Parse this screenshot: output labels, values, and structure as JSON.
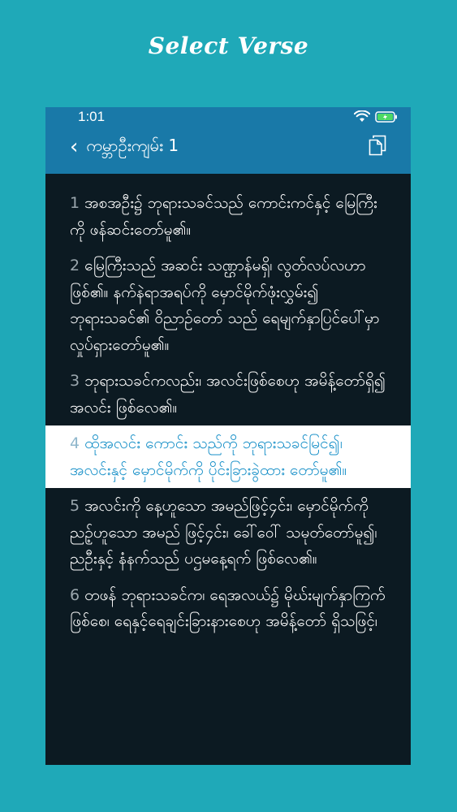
{
  "promo": {
    "title": "Select Verse"
  },
  "status_bar": {
    "time": "1:01"
  },
  "header": {
    "back_icon": "chevron-left-icon",
    "title": "ကမ္ဘာဦးကျမ်း 1",
    "copy_icon": "copy-icon"
  },
  "colors": {
    "background": "#1fa9b8",
    "appbar": "#1979a8",
    "content_bg": "#0c1a22",
    "selected_bg": "#ffffff",
    "selected_text": "#1890c8",
    "battery": "#4cd964"
  },
  "verses": [
    {
      "num": "1",
      "text": "အစအဦး၌ ဘုရားသခင်သည် ကောင်းကင်နှင့် မြေကြီးကို ဖန်ဆင်းတော်မူ၏။",
      "selected": false
    },
    {
      "num": "2",
      "text": "မြေကြီးသည် အဆင်း သဏ္ဌာန်မရှိ၊ လွတ်လပ်လဟာဖြစ်၏။ နက်နဲရာအရပ်ကို မှောင်မိုက်ဖုံးလွှမ်း၍ ဘုရားသခင်၏ ဝိညာဉ်တော် သည် ရေမျက်နှာပြင်ပေါ်မှာ လှုပ်ရှားတော်မူ၏။",
      "selected": false
    },
    {
      "num": "3",
      "text": "ဘုရားသခင်ကလည်း၊ အလင်းဖြစ်စေဟု အမိန့်တော်ရှိ၍ အလင်း ဖြစ်လေ၏။",
      "selected": false
    },
    {
      "num": "4",
      "text": "ထိုအလင်း ကောင်း သည်ကို ဘုရားသခင်မြင်၍၊ အလင်းနှင့် မှောင်မိုက်ကို ပိုင်းခြားခွဲထား တော်မူ၏။",
      "selected": true
    },
    {
      "num": "5",
      "text": "အလင်းကို နေ့ဟူသော အမည်ဖြင့်၄င်း၊ မှောင်မိုက်ကို ညဥ့်ဟူသော အမည် ဖြင့်၄င်း၊ ခေါ်ဝေါ် သမုတ်တော်မူ၍၊ ညဦးနှင့် နံနက်သည် ပဌမနေ့ရက် ဖြစ်လေ၏။",
      "selected": false
    },
    {
      "num": "6",
      "text": "တဖန် ဘုရားသခင်က၊ ရေအလယ်၌ မိုဃ်းမျက်နှာကြက်ဖြစ်စေ၊ ရေနှင့်ရေချင်းခြားနားစေဟု အမိန့်တော် ရှိသဖြင့်၊",
      "selected": false
    }
  ]
}
